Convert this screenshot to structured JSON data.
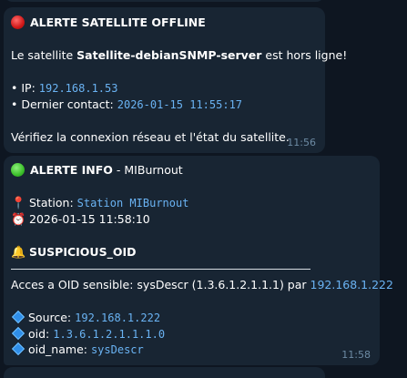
{
  "msg1": {
    "title": "ALERTE SATELLITE OFFLINE",
    "line1_prefix": "Le satellite ",
    "line1_name": "Satellite-debianSNMP-server",
    "line1_suffix": " est hors ligne!",
    "ip_label": "• IP: ",
    "ip_value": "192.168.1.53",
    "contact_label": "• Dernier contact: ",
    "contact_value": "2026-01-15 11:55:17",
    "footer": "Vérifiez la connexion réseau et l'état du satellite.",
    "time": "11:56"
  },
  "msg2": {
    "title": "ALERTE INFO",
    "title_suffix": " - MIBurnout",
    "station_label": "Station: ",
    "station_value": "Station MIBurnout",
    "timestamp": "2026-01-15 11:58:10",
    "section_title": "SUSPICIOUS_OID",
    "access_text": "Acces a OID sensible: sysDescr (1.3.6.1.2.1.1.1) par ",
    "access_ip": "192.168.1.222",
    "source_label": "Source: ",
    "source_value": "192.168.1.222",
    "oid_label": "oid: ",
    "oid_value": "1.3.6.1.2.1.1.1.0",
    "oidname_label": "oid_name: ",
    "oidname_value": "sysDescr",
    "time": "11:58"
  },
  "colors": {
    "background": "#0e1621",
    "bubble": "#182533",
    "link": "#6ab3f3",
    "timestamp": "#6d8ba4"
  },
  "icons": [
    "red-circle-icon",
    "green-circle-icon",
    "pushpin-icon",
    "alarm-clock-icon",
    "bell-icon",
    "blue-diamond-icon"
  ]
}
